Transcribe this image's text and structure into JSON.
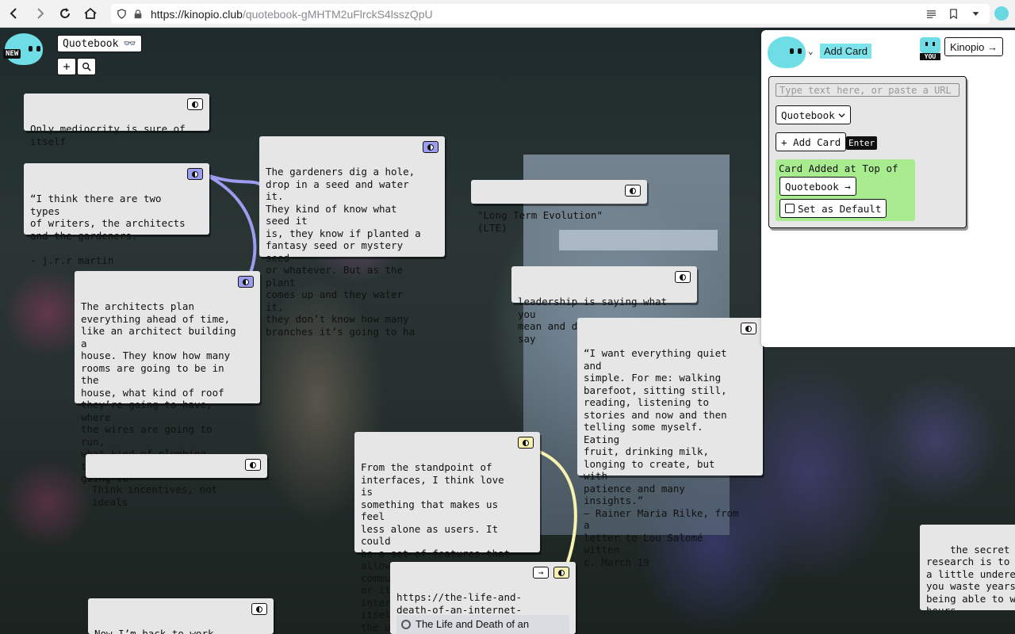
{
  "browser": {
    "url_host": "https://kinopio.club",
    "url_path": "/quotebook-gMHTM2uFlrckS4lsszQpU"
  },
  "header": {
    "new_badge": "NEW",
    "space_name": "Quotebook",
    "space_icon": "👓",
    "add_label": "+",
    "search_icon": "search-icon"
  },
  "cards": [
    {
      "text": "Only mediocrity is sure of\nitself"
    },
    {
      "text": "“I think there are two types\nof writers, the architects\nand the gardeners.\n\n- j.r.r martin"
    },
    {
      "text": "The gardeners dig a hole,\ndrop in a seed and water it.\nThey kind of know what seed it\nis, they know if planted a\nfantasy seed or mystery seed\nor whatever. But as the plant\ncomes up and they water it,\nthey don’t know how many\nbranches it’s going to ha"
    },
    {
      "text": "\"Long Term Evolution\" (LTE)"
    },
    {
      "text": "The architects plan\neverything ahead of time,\nlike an architect building a\nhouse. They know how many\nrooms are going to be in the\nhouse, what kind of roof\nthey’re going to have, where\nthe wires are going to run,\nwhat kind of plumbing there’s\ngoing to"
    },
    {
      "text": "leadership is saying what you\nmean and doing what you say"
    },
    {
      "text": "“I want everything quiet and\nsimple. For me: walking\nbarefoot, sitting still,\nreading, listening to\nstories and now and then\ntelling some myself. Eating\nfruit, drinking milk,\nlonging to create, but with\npatience and many insights.”\n— Rainer Maria Rilke, from a\nletter to Lou Salomé witten\nc. March 19"
    },
    {
      "text": "Think incentives, not ideals"
    },
    {
      "text": "From the standpoint of\ninterfaces, I think love is\nsomething that makes us feel\nless alone as users. It could\nbe a set of features that\nallows users to communicate,\nor it could be an interface\nitself that interacts with\nthe user."
    },
    {
      "text": "https://the-life-and-\ndeath-of-an-internet-\nonion.com",
      "preview": "The Life and Death of an"
    },
    {
      "text": "Now I’m back to work. Games\nneed to be made."
    },
    {
      "text": "the secret to doi\nresearch is to al\na little underemp\nyou waste years b\nbeing able to was\nhours."
    }
  ],
  "panel": {
    "add_card_tag": "Add Card",
    "you_label": "YOU",
    "kinopio_button": "Kinopio →",
    "input_placeholder": "Type text here, or paste a URL",
    "space_select": "Quotebook",
    "add_card_button": "+ Add Card",
    "enter_hint": "Enter",
    "success_message": "Card Added at Top of Space",
    "quotebook_link": "Quotebook →",
    "set_default_label": "Set as Default"
  },
  "colors": {
    "accent": "#6fdde6",
    "purple_connection": "#9c9cf0",
    "yellow_connection": "#f7f2b0",
    "success": "#a9ec8f"
  }
}
